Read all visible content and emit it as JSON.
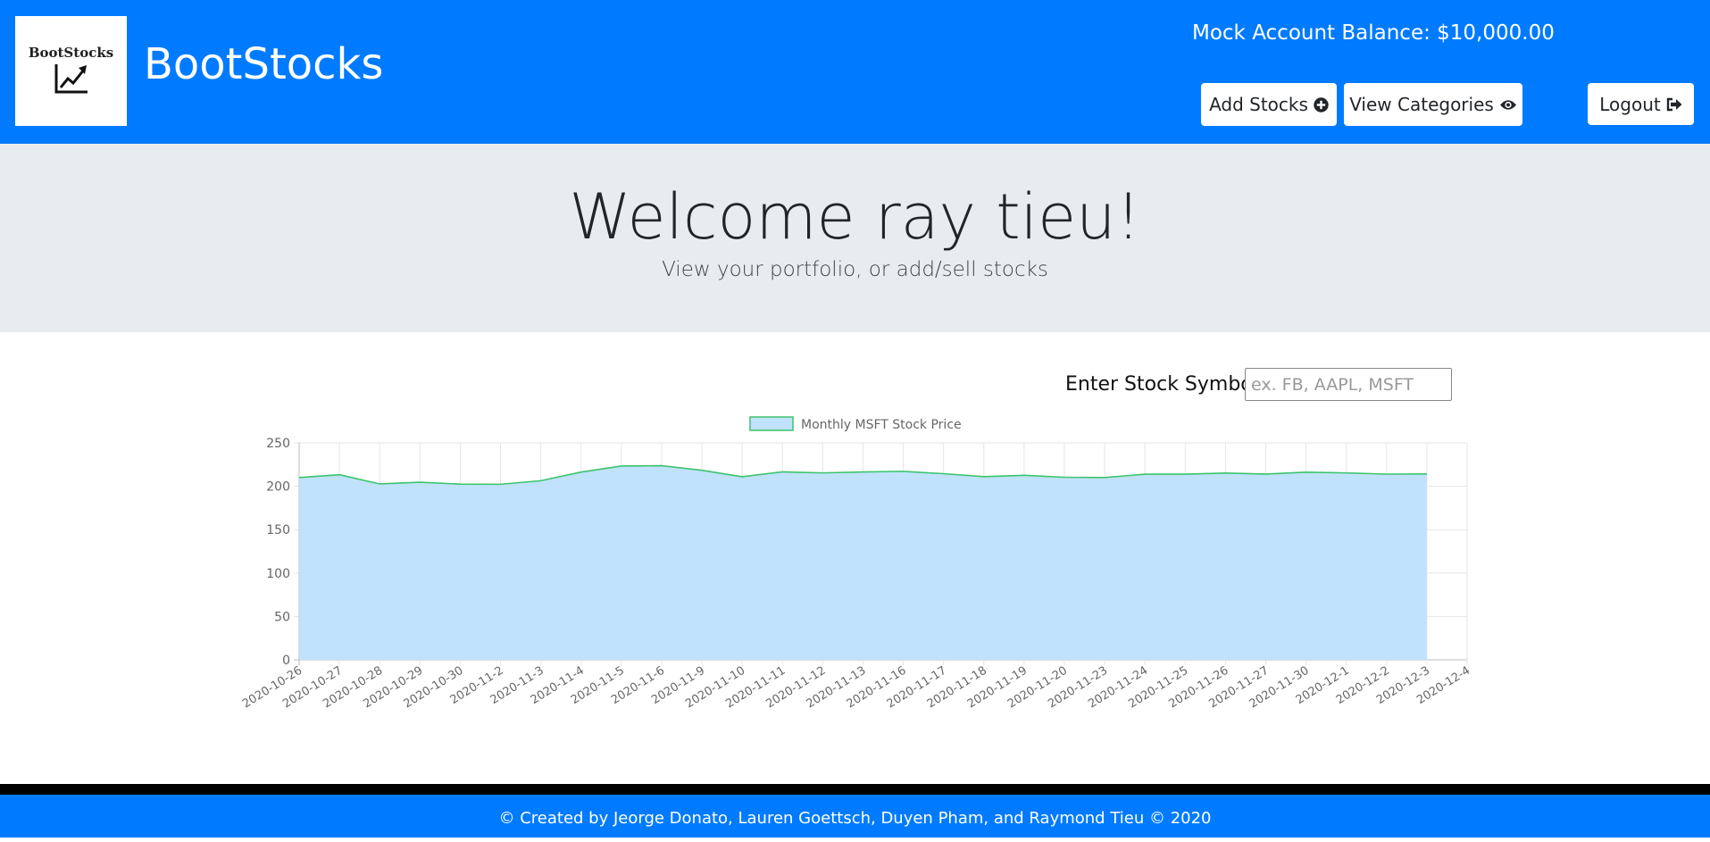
{
  "navbar": {
    "logo_text": "BootStocks",
    "brand": "BootStocks",
    "balance": "Mock Account Balance: $10,000.00",
    "buttons": {
      "add": "Add Stocks",
      "add_icon": "plus-circle-icon",
      "view": "View Categories",
      "view_icon": "eye-icon",
      "logout": "Logout",
      "logout_icon": "sign-out-icon"
    }
  },
  "jumbotron": {
    "title": "Welcome ray tieu!",
    "subtitle": "View your portfolio, or add/sell stocks"
  },
  "search": {
    "label": "Enter Stock Symbol:",
    "placeholder": "ex. FB, AAPL, MSFT",
    "value": ""
  },
  "chart_data": {
    "type": "area",
    "title": "",
    "xlabel": "",
    "ylabel": "",
    "ylim": [
      0,
      250
    ],
    "yticks": [
      0,
      50,
      100,
      150,
      200,
      250
    ],
    "grid": true,
    "legend": "top",
    "fill_color": "#c0e2fc",
    "line_color": "#3cc46b",
    "x": [
      "2020-10-26",
      "2020-10-27",
      "2020-10-28",
      "2020-10-29",
      "2020-10-30",
      "2020-11-2",
      "2020-11-3",
      "2020-11-4",
      "2020-11-5",
      "2020-11-6",
      "2020-11-9",
      "2020-11-10",
      "2020-11-11",
      "2020-11-12",
      "2020-11-13",
      "2020-11-16",
      "2020-11-17",
      "2020-11-18",
      "2020-11-19",
      "2020-11-20",
      "2020-11-23",
      "2020-11-24",
      "2020-11-25",
      "2020-11-26",
      "2020-11-27",
      "2020-11-30",
      "2020-12-1",
      "2020-12-2",
      "2020-12-3",
      "2020-12-4"
    ],
    "series": [
      {
        "name": "Monthly MSFT Stock Price",
        "values": [
          210.1,
          213.3,
          202.7,
          204.7,
          202.5,
          202.3,
          206.4,
          216.4,
          223.3,
          223.7,
          218.4,
          211.0,
          216.6,
          215.4,
          216.5,
          217.2,
          214.5,
          211.1,
          212.6,
          210.4,
          210.1,
          213.9,
          213.9,
          215.2,
          214.1,
          216.2,
          215.4,
          214.0,
          214.2,
          null
        ]
      }
    ]
  },
  "footer": {
    "text": "© Created by Jeorge Donato, Lauren Goettsch, Duyen Pham, and Raymond Tieu © 2020"
  }
}
